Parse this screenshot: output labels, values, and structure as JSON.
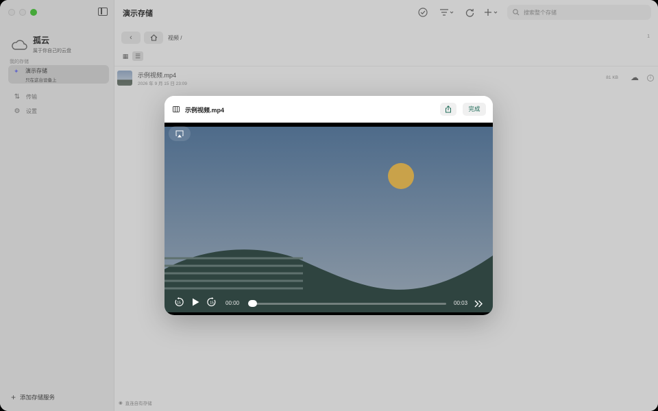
{
  "window": {
    "title": "演示存储"
  },
  "sidebar": {
    "account": {
      "name": "孤云",
      "subtitle": "属于你自己的云盘"
    },
    "section_label": "我的存储",
    "storage": {
      "name": "演示存储",
      "subtitle": "只在这台设备上"
    },
    "nav": [
      {
        "label": "传输",
        "icon": "transfer-icon"
      },
      {
        "label": "设置",
        "icon": "gear-icon"
      }
    ],
    "add_storage_label": "添加存储服务"
  },
  "toolbar": {
    "search_placeholder": "搜索整个存储",
    "icons": [
      "select-check-icon",
      "sort-filter-icon",
      "refresh-icon",
      "add-icon",
      "search-icon"
    ]
  },
  "navigation": {
    "breadcrumb": "视频 /",
    "item_count": "1"
  },
  "files": [
    {
      "name": "示例视频.mp4",
      "date": "2026 年 9 月 15 日 23:09",
      "size": "81 KB"
    }
  ],
  "footer": {
    "status": "直连自有存储"
  },
  "modal": {
    "title": "示例视频.mp4",
    "done_label": "完成",
    "player": {
      "current_time": "00:00",
      "duration": "00:03",
      "skip_back_seconds": "15",
      "skip_forward_seconds": "15",
      "progress": 0.0
    }
  },
  "colors": {
    "accent": "#1f6b58",
    "sky_top": "#4e6b8a",
    "sky_bottom": "#8e9aa6",
    "sun": "#c9a24a",
    "hill": "#2f4440",
    "traffic_green": "#49b23d"
  }
}
